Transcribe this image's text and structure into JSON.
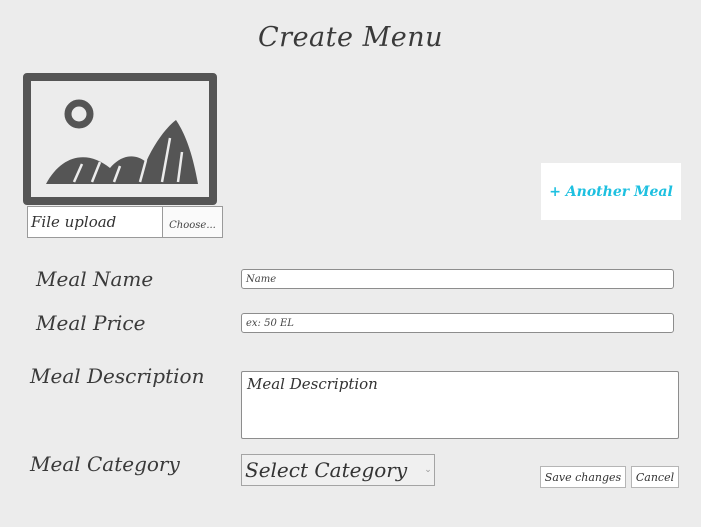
{
  "page": {
    "title": "Create Menu"
  },
  "image_upload": {
    "icon": "image-placeholder-icon",
    "file_label": "File upload",
    "choose_label": "Choose..."
  },
  "actions": {
    "another_meal_label": "+ Another Meal",
    "save_label": "Save changes",
    "cancel_label": "Cancel",
    "accent_color": "#1ec0e0"
  },
  "form": {
    "meal_name": {
      "label": "Meal Name",
      "placeholder": "Name"
    },
    "meal_price": {
      "label": "Meal Price",
      "placeholder": "ex: 50 EL"
    },
    "meal_description": {
      "label": "Meal Description",
      "placeholder": "Meal Description"
    },
    "meal_category": {
      "label": "Meal Category",
      "selected": "Select Category"
    }
  }
}
